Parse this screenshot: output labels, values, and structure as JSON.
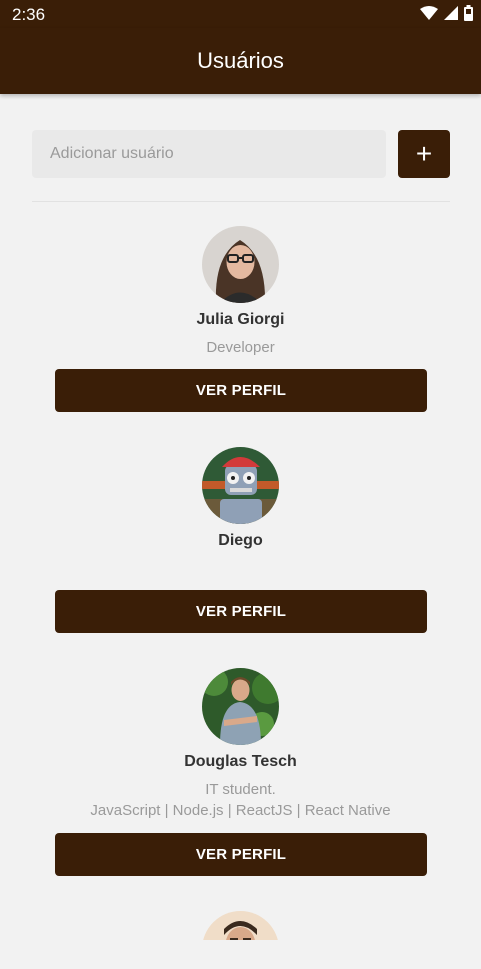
{
  "status_bar": {
    "time": "2:36"
  },
  "header": {
    "title": "Usuários"
  },
  "add_user": {
    "placeholder": "Adicionar usuário",
    "button_symbol": "+"
  },
  "users": [
    {
      "name": "Julia Giorgi",
      "bio_lines": [
        "Developer"
      ],
      "button_label": "VER PERFIL"
    },
    {
      "name": "Diego",
      "bio_lines": [],
      "button_label": "VER PERFIL"
    },
    {
      "name": "Douglas Tesch",
      "bio_lines": [
        "IT student.",
        "JavaScript | Node.js | ReactJS | React Native"
      ],
      "button_label": "VER PERFIL"
    }
  ],
  "colors": {
    "primary": "#3a1e07",
    "background": "#f2f2f2",
    "input_bg": "#e9e9e9",
    "muted_text": "#9a9a9a"
  }
}
